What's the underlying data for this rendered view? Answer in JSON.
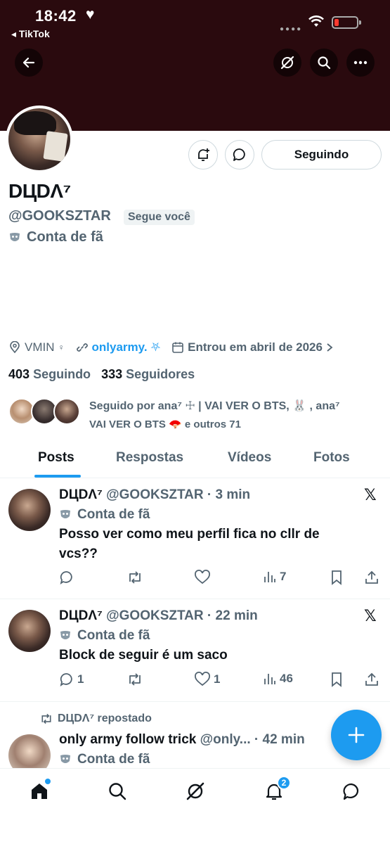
{
  "status_bar": {
    "time": "18:42",
    "heart": "♥",
    "back_app": "◂ TikTok"
  },
  "profile": {
    "name": "Dʟ̣ʟDΛ⁷",
    "display_name": "DЦDΛ⁷",
    "handle": "@GOOKSZTAR",
    "follows_you": "Segue você",
    "fan_label": "Conta de fã",
    "follow_button": "Seguindo",
    "location": "VMIN",
    "location_suffix": "♀",
    "link": "onlyarmy.",
    "link_suffix": "⛧",
    "joined": "Entrou em abril de 2026",
    "following_count": "403",
    "following_label": "Seguindo",
    "followers_count": "333",
    "followers_label": "Seguidores",
    "followed_by_line1": "Seguido por ana⁷ ☩ | VAI VER O BTS, 🐰 , ana⁷",
    "followed_by_line2": "VAI VER O BTS 🪭 e outros 71"
  },
  "tabs": [
    "Posts",
    "Respostas",
    "Vídeos",
    "Fotos"
  ],
  "posts": [
    {
      "name": "DЦDΛ⁷",
      "handle": "@GOOKSZTAR",
      "time": "· 3 min",
      "badge": "Conta de fã",
      "text": "Posso ver como meu perfil fica no cllr de vcs??",
      "replies": "",
      "reposts": "",
      "likes": "",
      "views": "7"
    },
    {
      "name": "DЦDΛ⁷",
      "handle": "@GOOKSZTAR",
      "time": "· 22 min",
      "badge": "Conta de fã",
      "text": "Block de seguir é um saco",
      "replies": "1",
      "reposts": "",
      "likes": "1",
      "views": "46"
    },
    {
      "repost_label": "DЦDΛ⁷ repostado",
      "name": "only army follow trick",
      "handle": "@only...",
      "time": "· 42 min",
      "badge": "Conta de fã"
    }
  ],
  "post_x_logo": "𝕏",
  "notifications_badge": "2",
  "icons": {
    "back": "arrow-left-icon",
    "grok": "grok-icon",
    "search": "search-icon",
    "more": "more-icon",
    "notify": "bell-plus-icon",
    "message": "message-icon",
    "fab": "plus-icon"
  },
  "colors": {
    "accent": "#1d9bf0",
    "banner": "#2a0a0e"
  }
}
